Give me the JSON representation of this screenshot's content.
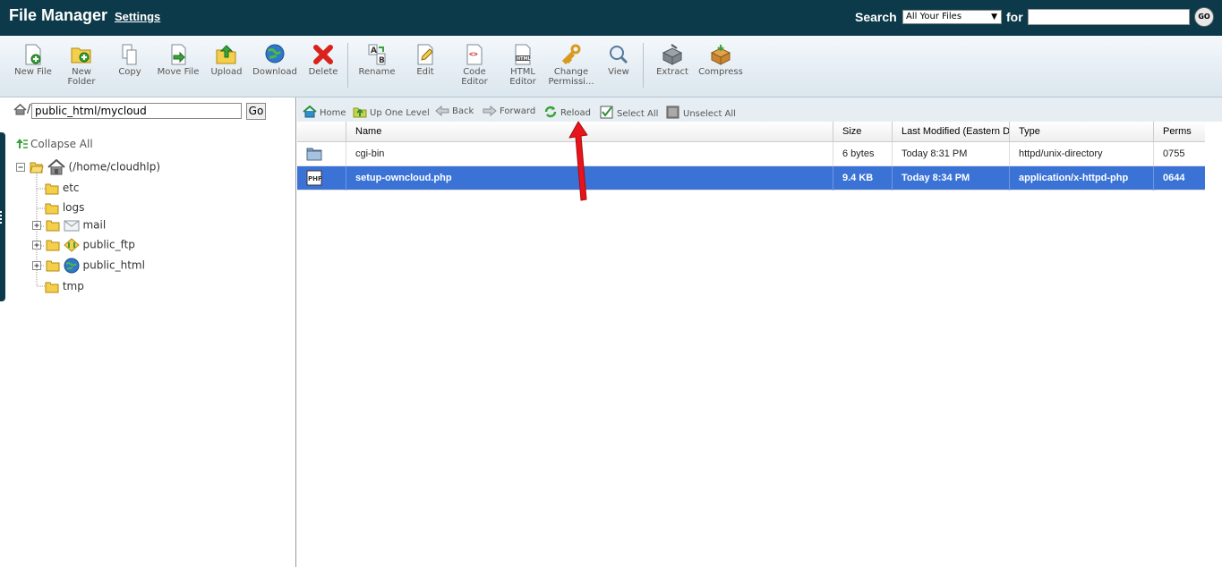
{
  "header": {
    "title": "File Manager",
    "settings_label": "Settings",
    "search_label": "Search",
    "search_scope": "All Your Files",
    "for_label": "for",
    "search_value": "",
    "go_label": "GO"
  },
  "toolbar": {
    "items": [
      {
        "label": "New File",
        "icon": "new-file-icon"
      },
      {
        "label": "New\nFolder",
        "icon": "new-folder-icon"
      },
      {
        "label": "Copy",
        "icon": "copy-icon"
      },
      {
        "label": "Move File",
        "icon": "move-file-icon"
      },
      {
        "label": "Upload",
        "icon": "upload-icon"
      },
      {
        "label": "Download",
        "icon": "download-icon"
      },
      {
        "label": "Delete",
        "icon": "delete-icon"
      },
      {
        "label": "Rename",
        "icon": "rename-icon"
      },
      {
        "label": "Edit",
        "icon": "edit-icon"
      },
      {
        "label": "Code\nEditor",
        "icon": "code-editor-icon"
      },
      {
        "label": "HTML\nEditor",
        "icon": "html-editor-icon"
      },
      {
        "label": "Change\nPermissi...",
        "icon": "change-permissions-icon"
      },
      {
        "label": "View",
        "icon": "view-icon"
      },
      {
        "label": "Extract",
        "icon": "extract-icon"
      },
      {
        "label": "Compress",
        "icon": "compress-icon"
      }
    ]
  },
  "path": {
    "slash": "/",
    "value": "public_html/mycloud",
    "go_label": "Go"
  },
  "tree": {
    "collapse_all": "Collapse All",
    "root": "(/home/cloudhlp)",
    "items": [
      "etc",
      "logs",
      "mail",
      "public_ftp",
      "public_html",
      "tmp"
    ]
  },
  "nav": {
    "home": "Home",
    "up": "Up One Level",
    "back": "Back",
    "forward": "Forward",
    "reload": "Reload",
    "select_all": "Select All",
    "unselect_all": "Unselect All"
  },
  "table": {
    "columns": [
      "Name",
      "Size",
      "Last Modified (Eastern D",
      "Type",
      "Perms"
    ],
    "rows": [
      {
        "name": "cgi-bin",
        "size": "6 bytes",
        "modified": "Today 8:31 PM",
        "type": "httpd/unix-directory",
        "perms": "0755",
        "icon": "folder-icon"
      },
      {
        "name": "setup-owncloud.php",
        "size": "9.4 KB",
        "modified": "Today 8:34 PM",
        "type": "application/x-httpd-php",
        "perms": "0644",
        "icon": "php-file-icon"
      }
    ]
  },
  "colors": {
    "header_bg": "#0d3a4a",
    "selected_row": "#3b72d6",
    "arrow": "#e8141c"
  }
}
